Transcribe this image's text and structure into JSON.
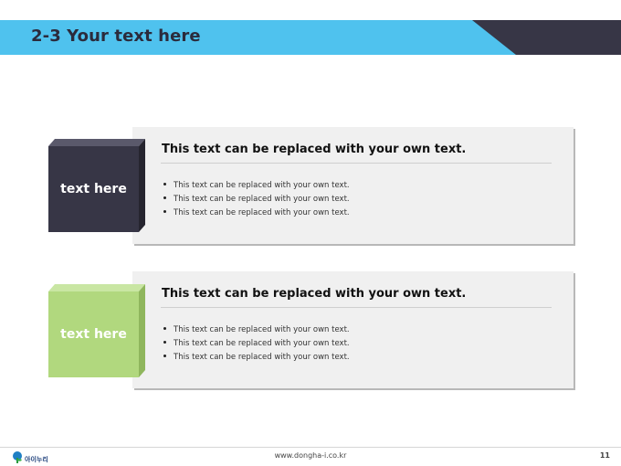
{
  "slide": {
    "title": "2-3 Your text here",
    "colors": {
      "header_blue": "#4fc2ee",
      "header_dark": "#373646",
      "box_dark": "#373646",
      "box_green": "#b1d87e",
      "card_bg": "#f0f0f0"
    }
  },
  "cards": [
    {
      "label": "text here",
      "heading": "This text can be replaced with your own text.",
      "bullets": [
        "This text can be replaced with your own text.",
        "This text can be replaced with your own text.",
        "This text can be replaced with your own text."
      ]
    },
    {
      "label": "text here",
      "heading": "This text can be replaced with your own text.",
      "bullets": [
        "This text can be replaced with your own text.",
        "This text can be replaced with your own text.",
        "This text can be replaced with your own text."
      ]
    }
  ],
  "footer": {
    "logo_text": "아이누리",
    "url": "www.dongha-i.co.kr",
    "page_number": "11"
  }
}
